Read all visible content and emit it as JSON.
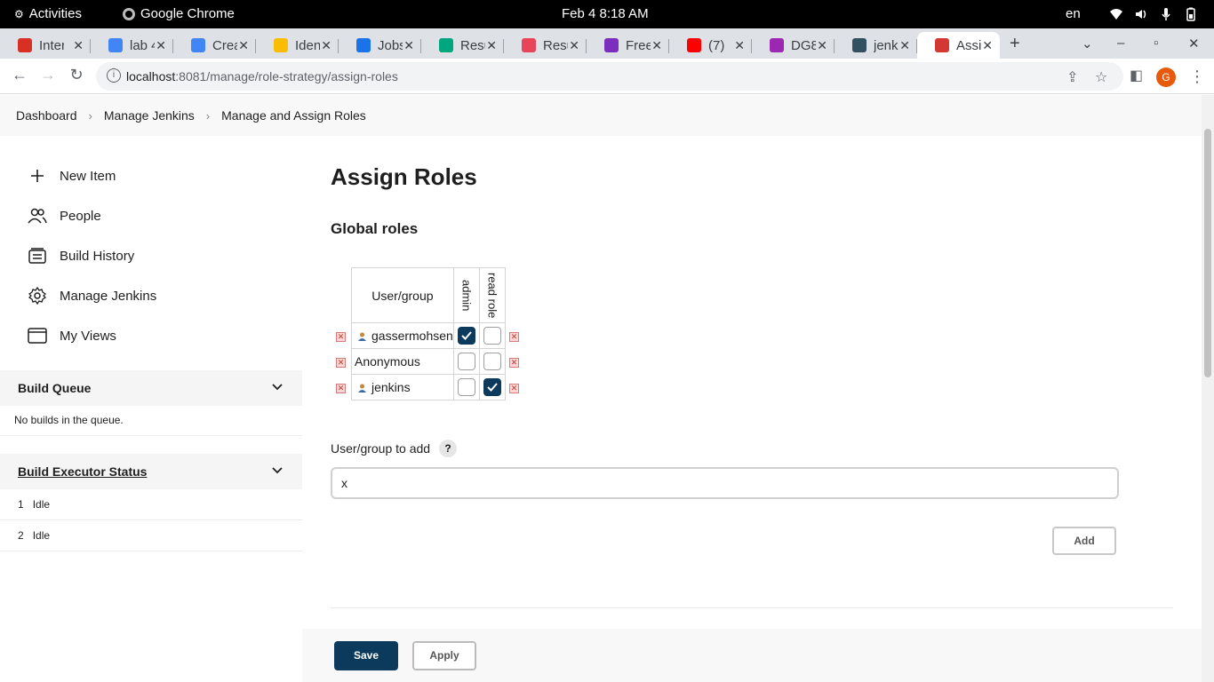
{
  "system": {
    "activities": "Activities",
    "app_name": "Google Chrome",
    "clock": "Feb 4   8:18 AM",
    "lang": "en"
  },
  "tabs": [
    {
      "title": "Inter",
      "color": "#d93025"
    },
    {
      "title": "lab 4",
      "color": "#4285f4"
    },
    {
      "title": "Crea",
      "color": "#4285f4"
    },
    {
      "title": "Iden",
      "color": "#fbbc04"
    },
    {
      "title": "Jobs",
      "color": "#1a73e8"
    },
    {
      "title": "Resu",
      "color": "#00a67e"
    },
    {
      "title": "Resu",
      "color": "#e8445a"
    },
    {
      "title": "Free",
      "color": "#7b2fbf"
    },
    {
      "title": "(7)",
      "color": "#ff0000"
    },
    {
      "title": "DG8",
      "color": "#9c27b0"
    },
    {
      "title": "jenk",
      "color": "#335061"
    },
    {
      "title": "Assi",
      "color": "#d33833"
    }
  ],
  "browser": {
    "url_host": "localhost",
    "url_rest": ":8081/manage/role-strategy/assign-roles",
    "profile_initial": "G"
  },
  "breadcrumbs": [
    "Dashboard",
    "Manage Jenkins",
    "Manage and Assign Roles"
  ],
  "sidebar": {
    "items": [
      {
        "label": "New Item",
        "icon": "plus-icon"
      },
      {
        "label": "People",
        "icon": "people-icon"
      },
      {
        "label": "Build History",
        "icon": "history-icon"
      },
      {
        "label": "Manage Jenkins",
        "icon": "gear-icon"
      },
      {
        "label": "My Views",
        "icon": "window-icon"
      }
    ],
    "build_queue": {
      "title": "Build Queue",
      "empty": "No builds in the queue."
    },
    "executors": {
      "title": "Build Executor Status",
      "rows": [
        {
          "num": "1",
          "status": "Idle"
        },
        {
          "num": "2",
          "status": "Idle"
        }
      ]
    }
  },
  "main": {
    "title": "Assign Roles",
    "section": "Global roles",
    "table": {
      "header_user": "User/group",
      "roles": [
        "admin",
        "read role"
      ],
      "rows": [
        {
          "name": "gassermohsen",
          "user_icon": true,
          "checks": [
            true,
            false
          ]
        },
        {
          "name": "Anonymous",
          "user_icon": false,
          "checks": [
            false,
            false
          ]
        },
        {
          "name": "jenkins",
          "user_icon": true,
          "checks": [
            false,
            true
          ]
        }
      ]
    },
    "add_label": "User/group to add",
    "help": "?",
    "add_value": "x",
    "add_button": "Add",
    "save_button": "Save",
    "apply_button": "Apply"
  },
  "colors": {
    "primary": "#0b3a5c"
  }
}
